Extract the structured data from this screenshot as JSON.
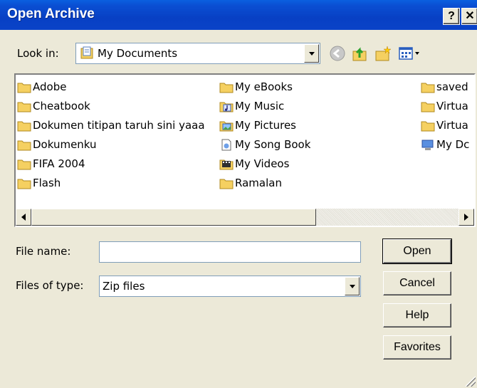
{
  "window": {
    "title": "Open Archive",
    "help_label": "?",
    "close_label": "✕"
  },
  "lookin": {
    "label": "Look in:",
    "value": "My Documents"
  },
  "files": [
    {
      "name": "Adobe",
      "icon": "folder-icon"
    },
    {
      "name": "Cheatbook",
      "icon": "folder-icon"
    },
    {
      "name": "Dokumen titipan taruh sini yaaa",
      "icon": "folder-icon"
    },
    {
      "name": "Dokumenku",
      "icon": "folder-icon"
    },
    {
      "name": "FIFA 2004",
      "icon": "folder-icon"
    },
    {
      "name": "Flash",
      "icon": "folder-icon"
    },
    {
      "name": "My eBooks",
      "icon": "folder-icon"
    },
    {
      "name": "My Music",
      "icon": "music-folder-icon"
    },
    {
      "name": "My Pictures",
      "icon": "pictures-folder-icon"
    },
    {
      "name": "My Song Book",
      "icon": "document-icon"
    },
    {
      "name": "My Videos",
      "icon": "videos-folder-icon"
    },
    {
      "name": "Ramalan",
      "icon": "folder-icon"
    },
    {
      "name": "saved",
      "icon": "folder-icon"
    },
    {
      "name": "Virtua",
      "icon": "folder-icon"
    },
    {
      "name": "Virtua",
      "icon": "folder-icon"
    },
    {
      "name": "My Dc",
      "icon": "computer-icon"
    }
  ],
  "form": {
    "filename_label": "File name:",
    "filename_value": "",
    "filetype_label": "Files of type:",
    "filetype_value": "Zip files"
  },
  "buttons": {
    "open": "Open",
    "cancel": "Cancel",
    "help": "Help",
    "favorites": "Favorites"
  },
  "colors": {
    "titlebar": "#0a4fd3",
    "dialog_bg": "#ece9d8",
    "folder": "#f5d061"
  }
}
